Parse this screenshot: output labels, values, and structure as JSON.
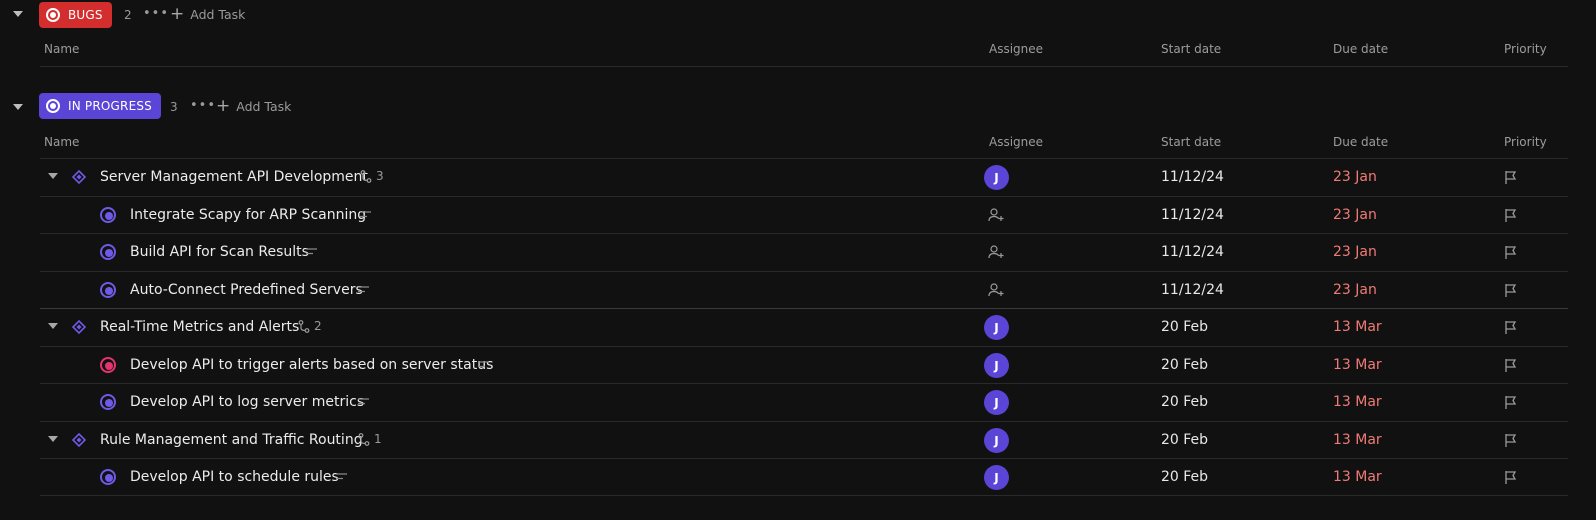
{
  "groups": [
    {
      "status_label": "BUGS",
      "count": "2",
      "more": "•••",
      "add_task": "Add Task",
      "columns": [
        "Name",
        "Assignee",
        "Start date",
        "Due date",
        "Priority"
      ]
    },
    {
      "status_label": "IN PROGRESS",
      "count": "3",
      "more": "•••",
      "add_task": "Add Task",
      "columns": [
        "Name",
        "Assignee",
        "Start date",
        "Due date",
        "Priority"
      ]
    }
  ],
  "colors": {
    "bugs": "#d42d2d",
    "in_progress": "#5a45d6",
    "due_overdue": "#f07a76",
    "subtask_red": "#e33371",
    "subtask_purple": "#6e5ae6"
  },
  "tasks": [
    {
      "name": "Server Management API Development",
      "subtasks": "3",
      "assignee": "J",
      "start": "11/12/24",
      "due": "23 Jan"
    },
    {
      "name": "Integrate Scapy for ARP Scanning",
      "assignee": "",
      "start": "11/12/24",
      "due": "23 Jan"
    },
    {
      "name": "Build API for Scan Results",
      "assignee": "",
      "start": "11/12/24",
      "due": "23 Jan"
    },
    {
      "name": "Auto-Connect Predefined Servers",
      "assignee": "",
      "start": "11/12/24",
      "due": "23 Jan"
    },
    {
      "name": "Real-Time Metrics and Alerts",
      "subtasks": "2",
      "assignee": "J",
      "start": "20 Feb",
      "due": "13 Mar"
    },
    {
      "name": "Develop API to trigger alerts based on server status",
      "assignee": "J",
      "start": "20 Feb",
      "due": "13 Mar"
    },
    {
      "name": "Develop API to log server metrics",
      "assignee": "J",
      "start": "20 Feb",
      "due": "13 Mar"
    },
    {
      "name": "Rule Management and Traffic Routing",
      "subtasks": "1",
      "assignee": "J",
      "start": "20 Feb",
      "due": "13 Mar"
    },
    {
      "name": "Develop API to schedule rules",
      "assignee": "J",
      "start": "20 Feb",
      "due": "13 Mar"
    }
  ]
}
